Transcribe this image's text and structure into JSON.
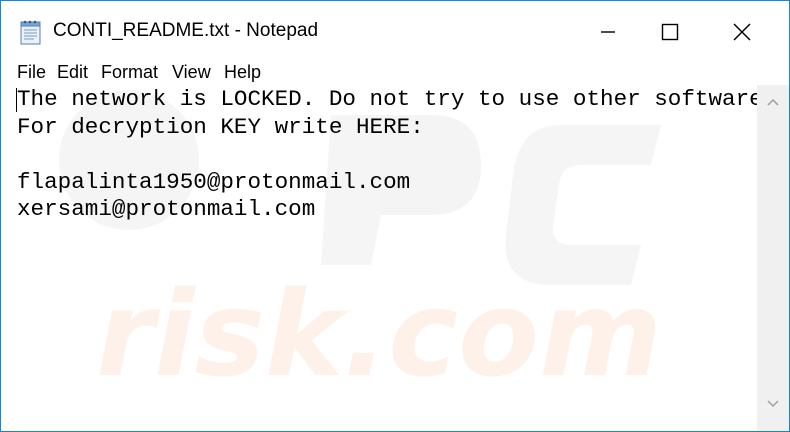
{
  "window": {
    "title": "CONTI_README.txt - Notepad",
    "accent_color": "#1883d7"
  },
  "titlebar_buttons": {
    "minimize_icon": "minimize-icon",
    "maximize_icon": "maximize-icon",
    "close_icon": "close-icon"
  },
  "menu": {
    "file": "File",
    "edit": "Edit",
    "format": "Format",
    "view": "View",
    "help": "Help"
  },
  "document": {
    "lines": [
      "The network is LOCKED. Do not try to use other software.",
      "For decryption KEY write HERE:",
      "",
      "flapalinta1950@protonmail.com",
      "xersami@protonmail.com"
    ]
  },
  "watermark": {
    "text": "risk.com"
  }
}
